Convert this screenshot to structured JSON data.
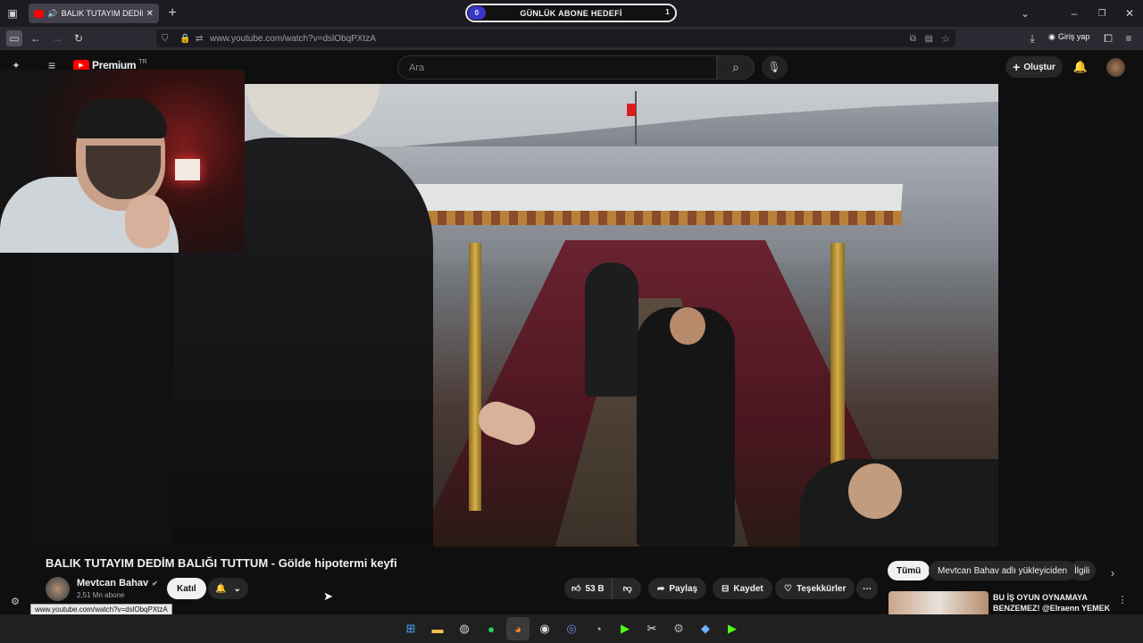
{
  "browser": {
    "tab_title": "BALIK TUTAYIM DEDİM BALIĞI TUTTUM",
    "url": "www.youtube.com/watch?v=dslObqPXtzA",
    "signin_label": "Giriş yap",
    "status_url": "www.youtube.com/watch?v=dslObqPXtzA"
  },
  "overlay": {
    "goal_label": "GÜNLÜK ABONE HEDEFİ",
    "goal_current": "0",
    "goal_target": "1"
  },
  "youtube": {
    "logo_text": "Premium",
    "logo_region": "TR",
    "search_placeholder": "Ara",
    "create_label": "Oluştur"
  },
  "video": {
    "title": "BALIK TUTAYIM DEDİM BALIĞI TUTTUM - Gölde hipotermi keyfi",
    "channel_name": "Mevtcan Bahav",
    "subscribers": "2,51 Mn abone",
    "join_label": "Katıl",
    "likes": "53 B",
    "share_label": "Paylaş",
    "save_label": "Kaydet",
    "thanks_label": "Teşekkürler"
  },
  "recommendations": {
    "chips": [
      "Tümü",
      "Mevtcan Bahav adlı yükleyiciden",
      "İlgili"
    ],
    "first_title": "BU İŞ OYUN OYNAMAYA BENZEMEZ! @Elraenn YEMEK ..."
  },
  "colors": {
    "accent": "#ff0000",
    "bg": "#0f0f0f"
  }
}
